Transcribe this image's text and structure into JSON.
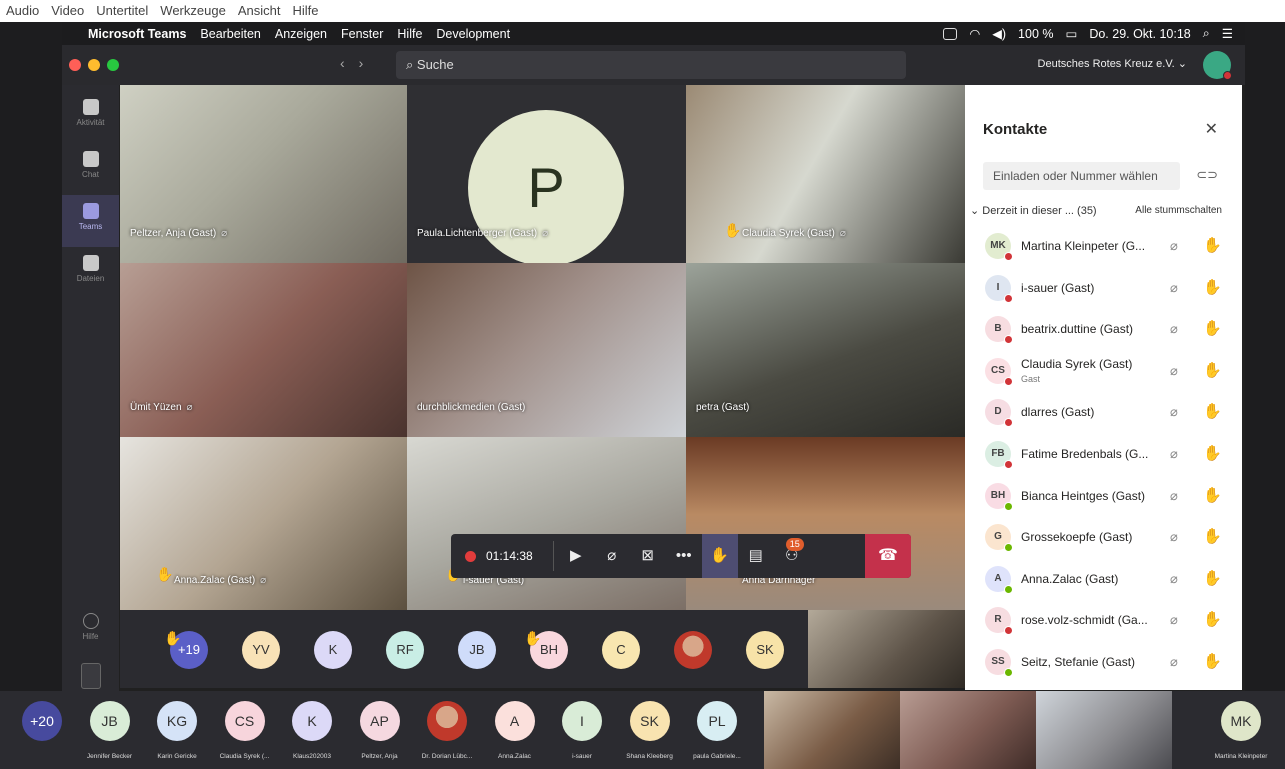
{
  "top_menu": [
    "Audio",
    "Video",
    "Untertitel",
    "Werkzeuge",
    "Ansicht",
    "Hilfe"
  ],
  "mac_menu": {
    "app": "Microsoft Teams",
    "items": [
      "Bearbeiten",
      "Anzeigen",
      "Fenster",
      "Hilfe",
      "Development"
    ],
    "battery": "100 %",
    "datetime": "Do. 29. Okt. 10:18"
  },
  "titlebar": {
    "search_placeholder": "Suche",
    "org": "Deutsches Rotes Kreuz e.V. ⌄"
  },
  "left_rail": [
    {
      "label": "Aktivität"
    },
    {
      "label": "Chat"
    },
    {
      "label": "Teams"
    },
    {
      "label": "Dateien"
    },
    {
      "label": "Hilfe"
    }
  ],
  "video_tiles": [
    {
      "name": "Peltzer, Anja (Gast)"
    },
    {
      "name": "Paula.Lichtenberger (Gast)",
      "initial": "P"
    },
    {
      "name": "Claudia Syrek (Gast)"
    },
    {
      "name": "Ümit Yüzen"
    },
    {
      "name": "durchblickmedien (Gast)"
    },
    {
      "name": "petra (Gast)"
    },
    {
      "name": "Anna.Zalac (Gast)"
    },
    {
      "name": "i-sauer (Gast)"
    },
    {
      "name": "Anna Darnhager"
    }
  ],
  "call_bar": {
    "timer": "01:14:38",
    "participants_badge": "15"
  },
  "strip_avatars": [
    {
      "initials": "+19",
      "color": "#5b5fc7",
      "hand": true
    },
    {
      "initials": "YV",
      "color": "#f8e2b7"
    },
    {
      "initials": "K",
      "color": "#dcd9f7"
    },
    {
      "initials": "RF",
      "color": "#c9eee5"
    },
    {
      "initials": "JB",
      "color": "#cfdcfa"
    },
    {
      "initials": "BH",
      "color": "#f9d7dd",
      "hand": true
    },
    {
      "initials": "C",
      "color": "#f8e6b0"
    },
    {
      "initials": "",
      "color": "#e9c9b3",
      "photo": true
    },
    {
      "initials": "SK",
      "color": "#f7e3a8"
    }
  ],
  "panel": {
    "title": "Kontakte",
    "invite_placeholder": "Einladen oder Nummer wählen",
    "section": "Derzeit in dieser ... (35)",
    "mute_all": "Alle stummschalten",
    "rows": [
      {
        "initials": "MK",
        "name": "Martina Kleinpeter (G...",
        "color": "#e2ecd0",
        "status": "#d13438"
      },
      {
        "initials": "I",
        "name": "i-sauer (Gast)",
        "color": "#dfe6f1",
        "status": "#d13438"
      },
      {
        "initials": "B",
        "name": "beatrix.duttine (Gast)",
        "color": "#f7dde1",
        "status": "#d13438"
      },
      {
        "initials": "CS",
        "name": "Claudia Syrek (Gast)",
        "sub": "Gast",
        "color": "#fbe0e4",
        "status": "#d13438"
      },
      {
        "initials": "D",
        "name": "dlarres (Gast)",
        "color": "#f6dde3",
        "status": "#d13438"
      },
      {
        "initials": "FB",
        "name": "Fatime Bredenbals (G...",
        "color": "#dbeee3",
        "status": "#d13438"
      },
      {
        "initials": "BH",
        "name": "Bianca Heintges (Gast)",
        "color": "#f9dce4",
        "status": "#6bb700"
      },
      {
        "initials": "G",
        "name": "Grossekoepfe (Gast)",
        "color": "#fbe5cf",
        "status": "#6bb700"
      },
      {
        "initials": "A",
        "name": "Anna.Zalac (Gast)",
        "color": "#dfe3fb",
        "status": "#6bb700"
      },
      {
        "initials": "R",
        "name": "rose.volz-schmidt (Ga...",
        "color": "#f7dde1",
        "status": "#d13438"
      },
      {
        "initials": "SS",
        "name": "Seitz, Stefanie (Gast)",
        "color": "#f7dde1",
        "status": "#6bb700"
      }
    ]
  },
  "bottom_bar": [
    {
      "initials": "+20",
      "color": "#474a9e",
      "name": ""
    },
    {
      "initials": "JB",
      "color": "#d9ecd7",
      "name": "Jennifer Becker"
    },
    {
      "initials": "KG",
      "color": "#d5e3f7",
      "name": "Karin Gericke"
    },
    {
      "initials": "CS",
      "color": "#f7d5dc",
      "name": "Claudia Syrek (..."
    },
    {
      "initials": "K",
      "color": "#dcd9f7",
      "name": "Klaus202003"
    },
    {
      "initials": "AP",
      "color": "#f5d8e0",
      "name": "Peltzer, Anja"
    },
    {
      "initials": "",
      "color": "#caa58f",
      "name": "Dr. Dorian Lübc...",
      "photo": true
    },
    {
      "initials": "A",
      "color": "#fbe0dc",
      "name": "Anna.Zalac"
    },
    {
      "initials": "I",
      "color": "#d9ecd7",
      "name": "i-sauer"
    },
    {
      "initials": "SK",
      "color": "#f8e3b0",
      "name": "Shana Kleeberg"
    },
    {
      "initials": "PL",
      "color": "#d8eef3",
      "name": "paula Gabriele..."
    }
  ],
  "bottom_last": {
    "initials": "MK",
    "name": "Martina Kleinpeter"
  }
}
